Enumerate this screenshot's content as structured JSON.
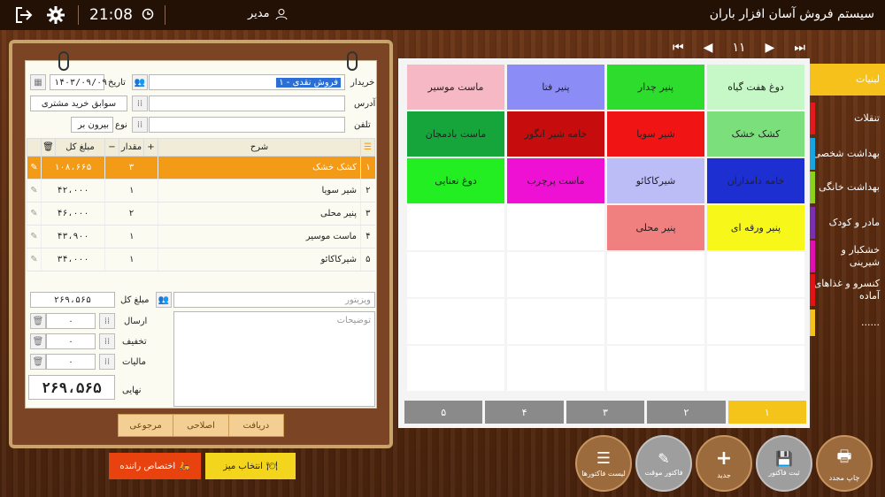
{
  "topbar": {
    "app_title": "سیستم فروش آسان افزار باران",
    "user_name": "مدیر",
    "clock": "21:08"
  },
  "pager": {
    "page": "۱۱"
  },
  "invoice": {
    "customer_label": "خریدار",
    "customer_value": "۱ - فروش نقدی",
    "date_label": "تاریخ",
    "date_value": "۱۴۰۳/۰۹/۰۹",
    "history_button": "سوابق خرید مشتری",
    "address_label": "آدرس",
    "address_value": "",
    "type_label": "نوع",
    "type_value": "بیرون بر",
    "phone_label": "تلفن",
    "phone_value": "",
    "columns": {
      "desc": "شرح",
      "qty": "مقدار",
      "total": "مبلغ کل"
    },
    "rows": [
      {
        "idx": "۱",
        "name": "کشک خشک",
        "qty": "۳",
        "total": "۱۰۸،۶۶۵"
      },
      {
        "idx": "۲",
        "name": "شیر سویا",
        "qty": "۱",
        "total": "۴۲،۰۰۰"
      },
      {
        "idx": "۳",
        "name": "پنیر محلی",
        "qty": "۲",
        "total": "۴۶،۰۰۰"
      },
      {
        "idx": "۴",
        "name": "ماست موسیر",
        "qty": "۱",
        "total": "۴۳،۹۰۰"
      },
      {
        "idx": "۵",
        "name": "شیرکاکائو",
        "qty": "۱",
        "total": "۳۴،۰۰۰"
      }
    ],
    "total_label": "مبلغ کل",
    "total_value": "۲۶۹،۵۶۵",
    "visitor_placeholder": "ویزیتور",
    "notes_placeholder": "توضیحات",
    "shipping_label": "ارسال",
    "shipping_value": "۰",
    "discount_label": "تخفیف",
    "discount_value": "۰",
    "tax_label": "مالیات",
    "tax_value": "۰",
    "final_label": "نهایی",
    "final_value": "۲۶۹،۵۶۵",
    "tabs": [
      "دریافت",
      "اصلاحی",
      "مرجوعی"
    ]
  },
  "actions": {
    "driver_button": "اختصاص راننده",
    "table_button": "انتخاب میز"
  },
  "products": [
    {
      "name": "دوغ هفت گیاه",
      "color": "#c6f7c6",
      "text": "#222"
    },
    {
      "name": "پنیر چدار",
      "color": "#2ddc2d",
      "text": "#222"
    },
    {
      "name": "پنیر فتا",
      "color": "#8c8cf7",
      "text": "#222"
    },
    {
      "name": "ماست موسیر",
      "color": "#f7b8c6",
      "text": "#222"
    },
    {
      "name": "کشک خشک",
      "color": "#7be07b",
      "text": "#222"
    },
    {
      "name": "شیر سویا",
      "color": "#f01414",
      "text": "#222"
    },
    {
      "name": "خامه شیر انگور",
      "color": "#c60c0c",
      "text": "#222"
    },
    {
      "name": "ماست بادمجان",
      "color": "#16a53a",
      "text": "#222"
    },
    {
      "name": "خامه دامداران",
      "color": "#1d2fd0",
      "text": "#222"
    },
    {
      "name": "شیرکاکائو",
      "color": "#bcbcf7",
      "text": "#222"
    },
    {
      "name": "ماست پرچرب",
      "color": "#ef11d3",
      "text": "#222"
    },
    {
      "name": "دوغ نعنایی",
      "color": "#22ee22",
      "text": "#222"
    },
    {
      "name": "پنیر ورقه ای",
      "color": "#f7f719",
      "text": "#222"
    },
    {
      "name": "پنیر محلی",
      "color": "#f07f7f",
      "text": "#222"
    }
  ],
  "pages": [
    "۱",
    "۲",
    "۳",
    "۴",
    "۵"
  ],
  "categories": [
    {
      "label": "لبنیات",
      "bg": "#f5c11a",
      "stripe": "#f5c11a"
    },
    {
      "label": "تنقلات",
      "bg": "transparent",
      "stripe": "#e11b1b"
    },
    {
      "label": "بهداشت شخصی",
      "bg": "transparent",
      "stripe": "#16a5e0"
    },
    {
      "label": "بهداشت خانگی",
      "bg": "transparent",
      "stripe": "#8bd11e"
    },
    {
      "label": "مادر و کودک",
      "bg": "transparent",
      "stripe": "#7b2fb0"
    },
    {
      "label": "خشکبار و شیرینی",
      "bg": "transparent",
      "stripe": "#e00fb0"
    },
    {
      "label": "کنسرو و غذاهای آماده",
      "bg": "transparent",
      "stripe": "#e01414"
    },
    {
      "label": "......",
      "bg": "transparent",
      "stripe": "#f5c11a"
    }
  ],
  "round_buttons": [
    "چاپ مجدد",
    "ثبت فاکتور",
    "جدید",
    "فاکتور موقت",
    "لیست فاکتورها"
  ]
}
